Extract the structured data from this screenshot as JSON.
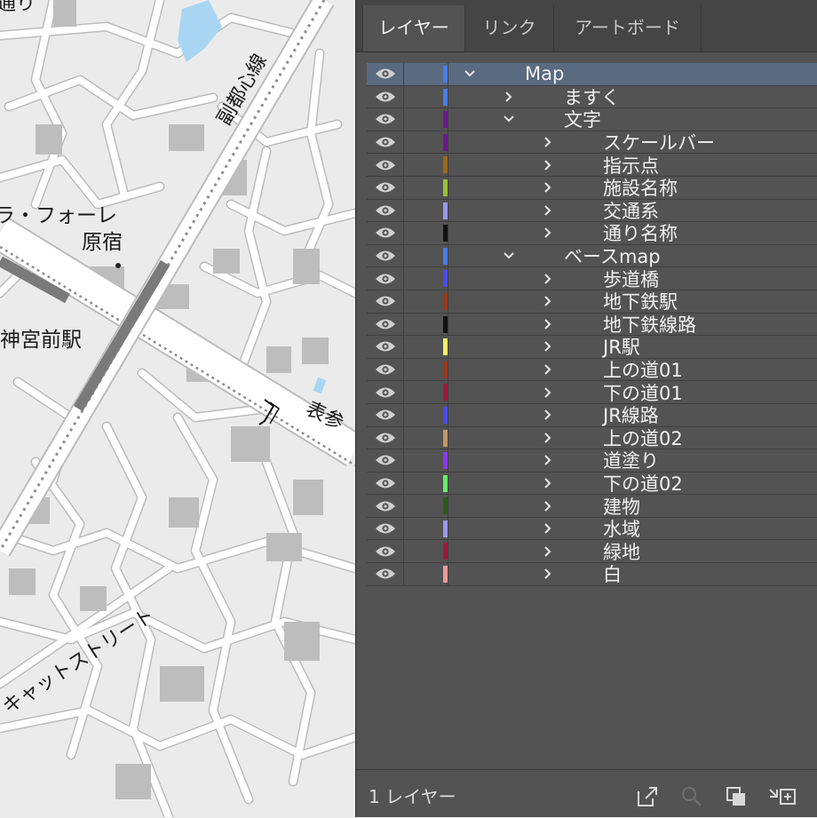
{
  "map": {
    "labels": {
      "fukutoshin_line": "副都心線",
      "facility_partial": "ラ・フォーレ",
      "harajuku": "原宿",
      "station": "神宮前駅",
      "omotesando": "表参",
      "cat_street": "キャットストリート",
      "top_fragment": "通り"
    }
  },
  "panel": {
    "tabs": [
      {
        "label": "レイヤー",
        "active": true
      },
      {
        "label": "リンク",
        "active": false
      },
      {
        "label": "アートボード",
        "active": false
      }
    ],
    "layers": [
      {
        "name": "Map",
        "depth": 0,
        "expanded": true,
        "color": "#4a7ee6",
        "selected": true
      },
      {
        "name": "ますく",
        "depth": 1,
        "expanded": false,
        "color": "#4a7ee6"
      },
      {
        "name": "文字",
        "depth": 1,
        "expanded": true,
        "color": "#6a1a8a"
      },
      {
        "name": "スケールバー",
        "depth": 2,
        "expanded": false,
        "color": "#6a1a8a"
      },
      {
        "name": "指示点",
        "depth": 2,
        "expanded": false,
        "color": "#9a6a1a"
      },
      {
        "name": "施設名称",
        "depth": 2,
        "expanded": false,
        "color": "#9ac23a"
      },
      {
        "name": "交通系",
        "depth": 2,
        "expanded": false,
        "color": "#9a9aee"
      },
      {
        "name": "通り名称",
        "depth": 2,
        "expanded": false,
        "color": "#111111"
      },
      {
        "name": "ベースmap",
        "depth": 1,
        "expanded": true,
        "color": "#4a7ee6"
      },
      {
        "name": "歩道橋",
        "depth": 2,
        "expanded": false,
        "color": "#4a4aee"
      },
      {
        "name": "地下鉄駅",
        "depth": 2,
        "expanded": false,
        "color": "#9a3a1a"
      },
      {
        "name": "地下鉄線路",
        "depth": 2,
        "expanded": false,
        "color": "#111111"
      },
      {
        "name": "JR駅",
        "depth": 2,
        "expanded": false,
        "color": "#ffee66"
      },
      {
        "name": "上の道01",
        "depth": 2,
        "expanded": false,
        "color": "#9a3a1a"
      },
      {
        "name": "下の道01",
        "depth": 2,
        "expanded": false,
        "color": "#9a1a3a"
      },
      {
        "name": "JR線路",
        "depth": 2,
        "expanded": false,
        "color": "#4a4aee"
      },
      {
        "name": "上の道02",
        "depth": 2,
        "expanded": false,
        "color": "#c09a6a"
      },
      {
        "name": "道塗り",
        "depth": 2,
        "expanded": false,
        "color": "#8a3aee"
      },
      {
        "name": "下の道02",
        "depth": 2,
        "expanded": false,
        "color": "#6aee6a"
      },
      {
        "name": "建物",
        "depth": 2,
        "expanded": false,
        "color": "#2a5a1a"
      },
      {
        "name": "水域",
        "depth": 2,
        "expanded": false,
        "color": "#9a9aee"
      },
      {
        "name": "緑地",
        "depth": 2,
        "expanded": false,
        "color": "#9a1a3a"
      },
      {
        "name": "白",
        "depth": 2,
        "expanded": false,
        "color": "#ee9a9a"
      }
    ],
    "footer": {
      "layer_count": "1 レイヤー",
      "icons": [
        "export-icon",
        "search-icon",
        "clipping-mask-icon",
        "new-sublayer-icon"
      ]
    }
  }
}
